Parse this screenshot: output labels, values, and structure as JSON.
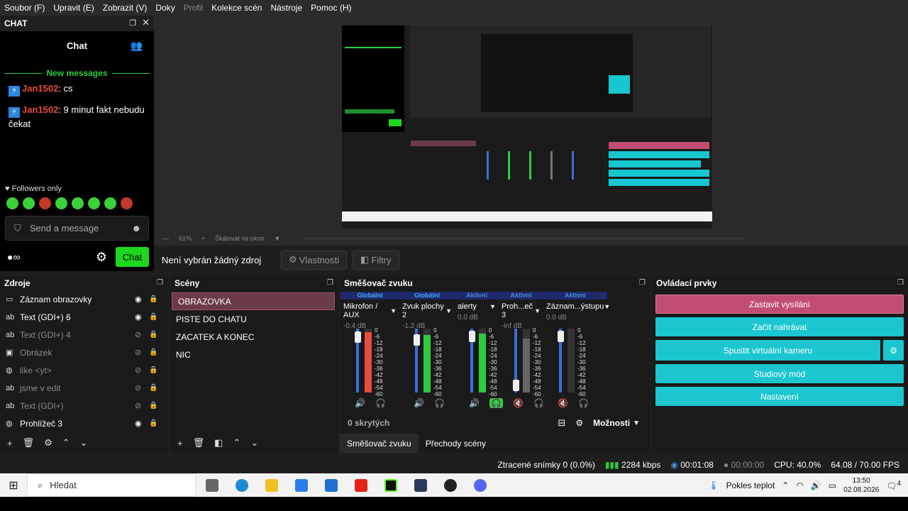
{
  "menubar": {
    "items": [
      "Soubor (F)",
      "Upravit (E)",
      "Zobrazit (V)",
      "Doky",
      "Profil",
      "Kolekce scén",
      "Nástroje",
      "Pomoc (H)"
    ]
  },
  "chat": {
    "dock_title": "CHAT",
    "tab_label": "Chat",
    "new_messages": "New messages",
    "messages": [
      {
        "user": "Jan1502",
        "text": ": cs"
      },
      {
        "user": "Jan1502",
        "text": ": 9 minut fakt nebudu čekat"
      }
    ],
    "followers_only": "Followers only",
    "send_placeholder": "Send a message",
    "send_button": "Chat"
  },
  "preview": {
    "zoom": "61%",
    "scale_label": "Škálovat na okno"
  },
  "source_toolbar": {
    "no_source": "Není vybrán žádný zdroj",
    "properties": "Vlastnosti",
    "filters": "Filtry"
  },
  "sources": {
    "title": "Zdroje",
    "items": [
      {
        "label": "Záznam obrazovky",
        "icon": "monitor-icon",
        "visible": true
      },
      {
        "label": "Text (GDI+) 6",
        "icon": "text-icon",
        "visible": true
      },
      {
        "label": "Text (GDI+) 4",
        "icon": "text-icon",
        "visible": false
      },
      {
        "label": "Obrázek",
        "icon": "image-icon",
        "visible": false
      },
      {
        "label": "like <yt>",
        "icon": "globe-icon",
        "visible": false
      },
      {
        "label": "jsme v edit",
        "icon": "text-icon",
        "visible": false
      },
      {
        "label": "Text (GDI+)",
        "icon": "text-icon",
        "visible": false
      },
      {
        "label": "Prohlížeč 3",
        "icon": "globe-icon",
        "visible": true
      }
    ]
  },
  "scenes": {
    "title": "Scény",
    "items": [
      "OBRAZOVKA",
      "PISTE DO CHATU",
      "ZACATEK A KONEC",
      "NIC"
    ]
  },
  "mixer": {
    "title": "Směšovač zvuku",
    "channels": [
      {
        "tag": "Globální",
        "name": "Mikrofon / AUX",
        "db": "-0.4 dB",
        "muted": false,
        "fader": 0.95,
        "meter": 0.95,
        "meter_color": "#e74c3c"
      },
      {
        "tag": "Globální",
        "name": "Zvuk plochy 2",
        "db": "-1.2 dB",
        "muted": false,
        "fader": 0.9,
        "meter": 0.9,
        "meter_color": "#2ecc40"
      },
      {
        "tag": "Aktivní",
        "name": "alerty",
        "db": "0.0 dB",
        "muted": false,
        "fader": 0.96,
        "meter": 0.92,
        "meter_color": "#2ecc40"
      },
      {
        "tag": "Aktivní",
        "name": "Proh...eč 3",
        "db": "-inf dB",
        "muted": true,
        "fader": 0.1,
        "meter": 0.85,
        "meter_color": "#666666"
      },
      {
        "tag": "Aktivní",
        "name": "Záznam...ýstupu",
        "db": "0.0 dB",
        "muted": true,
        "fader": 0.96,
        "meter": 0.0,
        "meter_color": "#666666"
      }
    ],
    "scale": [
      "0",
      "-6",
      "-12",
      "-18",
      "-24",
      "-30",
      "-36",
      "-42",
      "-48",
      "-54",
      "-60"
    ],
    "hidden": "0 skrytých",
    "options": "Možnosti",
    "tabs": [
      "Směšovač zvuku",
      "Přechody scény"
    ]
  },
  "controls": {
    "title": "Ovládací prvky",
    "stop_stream": "Zastavit vysílání",
    "start_record": "Začít nahrávat",
    "virtual_cam": "Spustit virtuální kameru",
    "studio_mode": "Studiový mód",
    "settings": "Nastavení"
  },
  "status": {
    "dropped": "Ztracené snímky 0 (0.0%)",
    "bitrate": "2284 kbps",
    "stream_time": "00:01:08",
    "rec_time": "00:00:00",
    "cpu": "CPU: 40.0%",
    "fps": "64.08 / 70.00 FPS"
  },
  "taskbar": {
    "search": "Hledat",
    "weather": "Pokles teplot",
    "time": "13:50",
    "date": "02.08.2026",
    "notif": "4"
  }
}
